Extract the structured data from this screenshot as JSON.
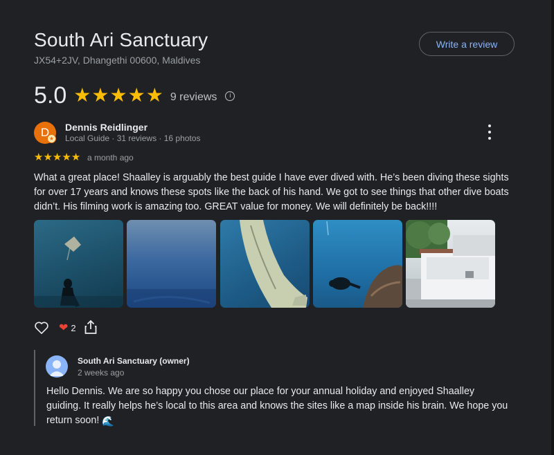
{
  "place": {
    "name": "South Ari Sanctuary",
    "address": "JX54+2JV, Dhangethi 00600, Maldives",
    "write_review_label": "Write a review",
    "rating": "5.0",
    "stars": 5,
    "review_count": "9 reviews"
  },
  "review": {
    "avatar_letter": "D",
    "author": "Dennis Reidlinger",
    "meta": "Local Guide · 31 reviews · 16 photos",
    "stars": 5,
    "time": "a month ago",
    "text": "What a great place! Shaalley is arguably the best guide I have ever dived with. He’s been diving these sights for over 17 years and knows these spots like the back of his hand. We got to see things that other dive boats didn’t. His filming work is amazing too. GREAT value for money. We will definitely be back!!!!",
    "photos": [
      "manta-ray-diver",
      "open-blue-water",
      "manta-ray-wing",
      "diver-near-reef",
      "dive-center-building"
    ],
    "reaction_count": "2"
  },
  "owner_reply": {
    "author": "South Ari Sanctuary (owner)",
    "time": "2 weeks ago",
    "text": "Hello Dennis. We are so happy you chose our place for your annual holiday and enjoyed Shaalley guiding. It really helps he’s local to this area and knows the sites like a map inside his brain. We hope you return soon!",
    "emoji": "🌊"
  },
  "colors": {
    "background": "#202124",
    "star": "#fbbc04",
    "accent_link": "#8ab4f8",
    "avatar": "#e8710a",
    "heart": "#ea4335"
  }
}
